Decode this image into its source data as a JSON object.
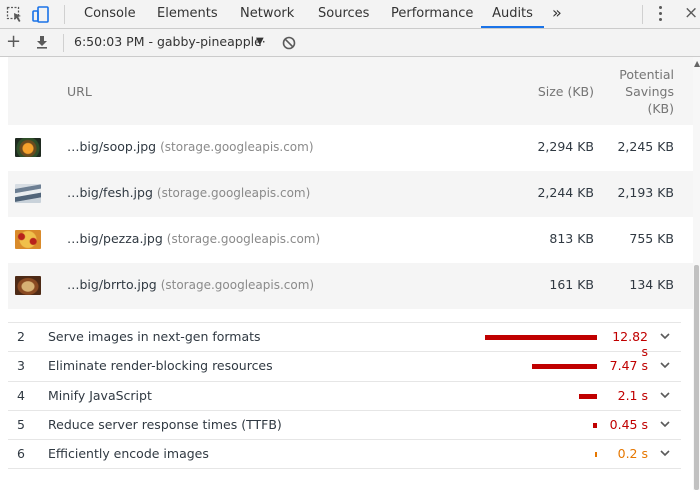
{
  "devtools": {
    "tabs": [
      {
        "label": "Console"
      },
      {
        "label": "Elements"
      },
      {
        "label": "Network"
      },
      {
        "label": "Sources"
      },
      {
        "label": "Performance"
      },
      {
        "label": "Audits",
        "active": true
      }
    ],
    "more_tabs": "»",
    "close": "×"
  },
  "toolbar": {
    "report_label": "6:50:03 PM - gabby-pineapple·",
    "caret": "▼"
  },
  "details": {
    "headers": {
      "url": "URL",
      "size": "Size (KB)",
      "savings_line1": "Potential",
      "savings_line2": "Savings",
      "savings_line3": "(KB)"
    },
    "rows": [
      {
        "path": "…big/soop.jpg",
        "host": "(storage.googleapis.com)",
        "size": "2,294 KB",
        "savings": "2,245 KB"
      },
      {
        "path": "…big/fesh.jpg",
        "host": "(storage.googleapis.com)",
        "size": "2,244 KB",
        "savings": "2,193 KB"
      },
      {
        "path": "…big/pezza.jpg",
        "host": "(storage.googleapis.com)",
        "size": "813 KB",
        "savings": "755 KB"
      },
      {
        "path": "…big/brrto.jpg",
        "host": "(storage.googleapis.com)",
        "size": "161 KB",
        "savings": "134 KB"
      }
    ]
  },
  "audits": [
    {
      "num": "2",
      "title": "Serve images in next-gen formats",
      "value": "12.82 s",
      "seconds": 12.82,
      "color": "#c00000"
    },
    {
      "num": "3",
      "title": "Eliminate render-blocking resources",
      "value": "7.47 s",
      "seconds": 7.47,
      "color": "#c00000"
    },
    {
      "num": "4",
      "title": "Minify JavaScript",
      "value": "2.1 s",
      "seconds": 2.1,
      "color": "#c00000"
    },
    {
      "num": "5",
      "title": "Reduce server response times (TTFB)",
      "value": "0.45 s",
      "seconds": 0.45,
      "color": "#c00000"
    },
    {
      "num": "6",
      "title": "Efficiently encode images",
      "value": "0.2 s",
      "seconds": 0.2,
      "color": "#e67700"
    }
  ],
  "colors": {
    "accent": "#1a73e8",
    "fail": "#c00000",
    "average": "#e67700"
  }
}
